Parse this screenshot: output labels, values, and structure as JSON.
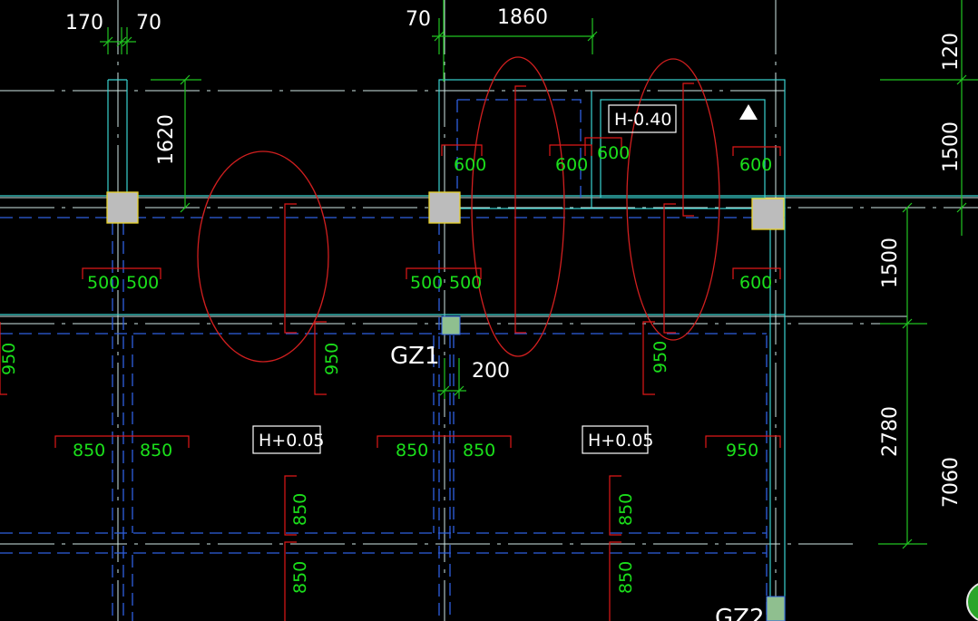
{
  "colors": {
    "background": "#000000",
    "axis": "#cfe9e6",
    "wall": "#39d3d0",
    "beam_dashed": "#2f5fe0",
    "dimension": "#21c421",
    "rebar": "#e01818",
    "rebar_text": "#1be01b",
    "column": "#bcbcbc",
    "column_edge": "#e8d22a",
    "column_green": "#8fbf8f",
    "markup": "#d11f1f",
    "text": "#ffffff"
  },
  "dimensions": {
    "d170": "170",
    "d70_left": "70",
    "d70_top": "70",
    "d1860": "1860",
    "d120": "120",
    "d1620": "1620",
    "d1500_top": "1500",
    "d1500_mid": "1500",
    "d2780": "2780",
    "d7060": "7060",
    "d200": "200"
  },
  "elevations": {
    "top_right": "H-0.40",
    "bottom_left": "H+0.05",
    "bottom_right": "H+0.05"
  },
  "columns": {
    "gz1": "GZ1",
    "gz2": "GZ2"
  },
  "rebar_labels": {
    "r600_a": "600",
    "r600_b": "600",
    "r600_c": "600",
    "r600_d": "600",
    "r600_e": "600",
    "r500_a": "500",
    "r500_b": "500",
    "r500_c": "500",
    "r500_d": "500",
    "r950_edge": "950",
    "r950_a": "950",
    "r950_b": "950",
    "r950_c": "950",
    "r850_a": "850",
    "r850_b": "850",
    "r850_c": "850",
    "r850_d": "850",
    "r850_v1": "850",
    "r850_v2": "850",
    "r850_v3": "850",
    "r850_v4": "850"
  }
}
